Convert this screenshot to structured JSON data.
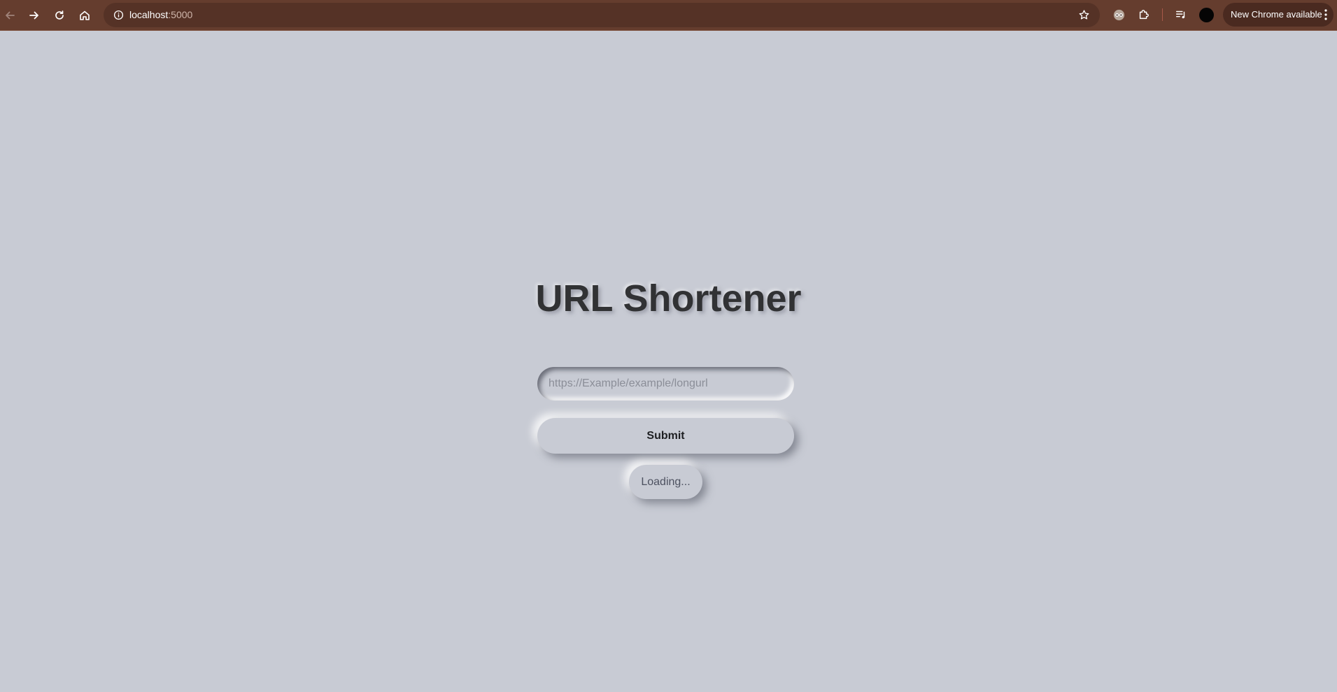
{
  "browser": {
    "url_host": "localhost",
    "url_port": ":5000",
    "update_chip_label": "New Chrome available",
    "icons": {
      "back": "back-arrow-icon",
      "forward": "forward-arrow-icon",
      "reload": "reload-icon",
      "home": "home-icon",
      "site_info": "info-icon",
      "bookmark": "star-icon",
      "extension_1": "eye-mask-icon",
      "extensions": "puzzle-icon",
      "media": "media-queue-icon",
      "menu": "kebab-menu-icon"
    },
    "colors": {
      "toolbar": "#653d2e",
      "omnibox": "#553226"
    }
  },
  "page": {
    "title": "URL Shortener",
    "input_placeholder": "https://Example/example/longurl",
    "submit_label": "Submit",
    "loading_label": "Loading...",
    "colors": {
      "background": "#c8cbd4",
      "title": "#313234"
    }
  }
}
